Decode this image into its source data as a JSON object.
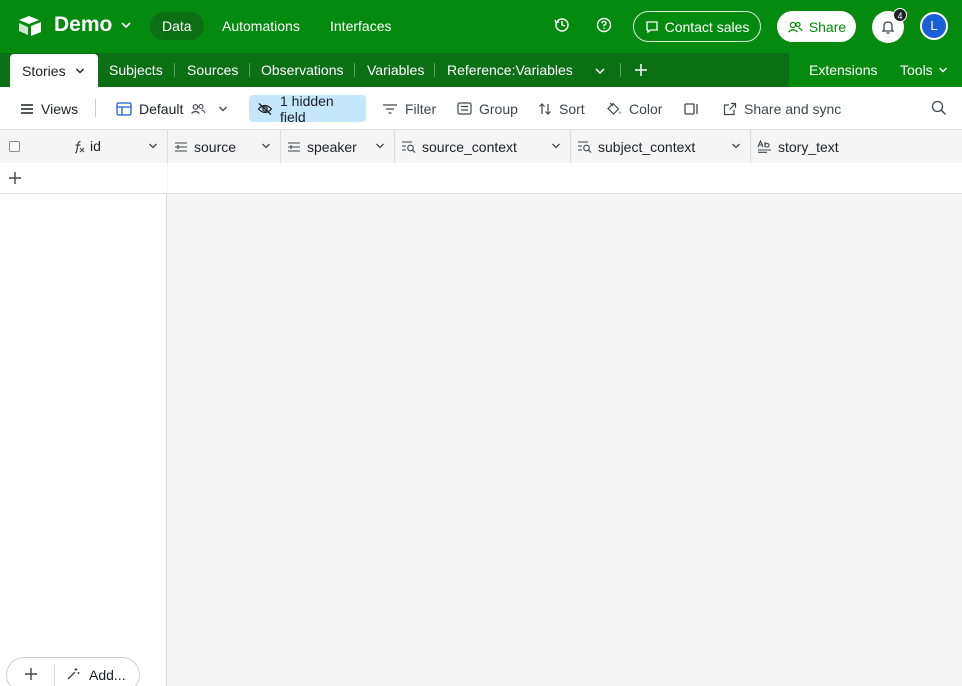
{
  "topbar": {
    "base_name": "Demo",
    "nav": [
      {
        "label": "Data",
        "active": true
      },
      {
        "label": "Automations",
        "active": false
      },
      {
        "label": "Interfaces",
        "active": false
      }
    ],
    "contact_sales_label": "Contact sales",
    "share_label": "Share",
    "notification_count": "4",
    "avatar_initial": "L",
    "brand_color": "#048a0e"
  },
  "tables": {
    "tabs": [
      "Stories",
      "Subjects",
      "Sources",
      "Observations",
      "Variables",
      "Reference:Variables"
    ],
    "active": "Stories",
    "extensions_label": "Extensions",
    "tools_label": "Tools"
  },
  "viewbar": {
    "views_label": "Views",
    "view_name": "Default",
    "hidden_fields_label": "1 hidden field",
    "filter_label": "Filter",
    "group_label": "Group",
    "sort_label": "Sort",
    "color_label": "Color",
    "share_sync_label": "Share and sync"
  },
  "grid": {
    "columns": [
      {
        "name": "id",
        "icon": "formula-icon"
      },
      {
        "name": "source",
        "icon": "link-icon"
      },
      {
        "name": "speaker",
        "icon": "link-icon"
      },
      {
        "name": "source_context",
        "icon": "lookup-icon"
      },
      {
        "name": "subject_context",
        "icon": "lookup-icon"
      },
      {
        "name": "story_text",
        "icon": "long-text-icon"
      }
    ]
  },
  "footer": {
    "add_label": "Add..."
  }
}
